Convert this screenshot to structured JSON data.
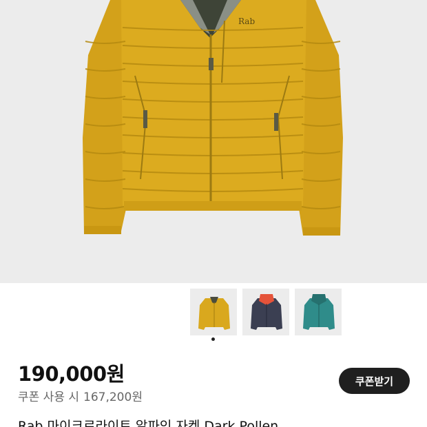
{
  "product": {
    "brand_logo": "Rab",
    "image_name": "yellow-down-jacket",
    "thumbnails": [
      {
        "name": "yellow-jacket-thumb",
        "color": "#d9a81e"
      },
      {
        "name": "navy-jacket-thumb",
        "color": "#3b3f52"
      },
      {
        "name": "teal-jacket-thumb",
        "color": "#2f8c8a"
      }
    ],
    "price": "190,000원",
    "coupon_label": "쿠폰 사용 시",
    "coupon_price": "167,200원",
    "coupon_button": "쿠폰받기",
    "title": "Rab 마이크로라이트 알파인 자켓 Dark Pollen"
  },
  "colors": {
    "jacket": "#d9a81e",
    "button_bg": "#1f1f1f"
  }
}
